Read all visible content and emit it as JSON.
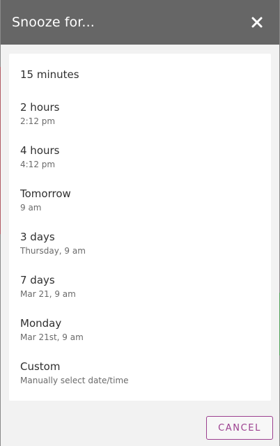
{
  "dialog": {
    "title": "Snooze for...",
    "close_icon": "close-icon",
    "options": [
      {
        "label": "15 minutes",
        "sub": ""
      },
      {
        "label": "2 hours",
        "sub": "2:12 pm"
      },
      {
        "label": "4 hours",
        "sub": "4:12 pm"
      },
      {
        "label": "Tomorrow",
        "sub": "9 am"
      },
      {
        "label": "3 days",
        "sub": "Thursday, 9 am"
      },
      {
        "label": "7 days",
        "sub": "Mar 21, 9 am"
      },
      {
        "label": "Monday",
        "sub": "Mar 21st, 9 am"
      },
      {
        "label": "Custom",
        "sub": "Manually select date/time"
      }
    ],
    "cancel_label": "CANCEL"
  },
  "colors": {
    "header_bg": "#666666",
    "accent": "#9b3f8f",
    "panel_bg": "#ffffff"
  }
}
